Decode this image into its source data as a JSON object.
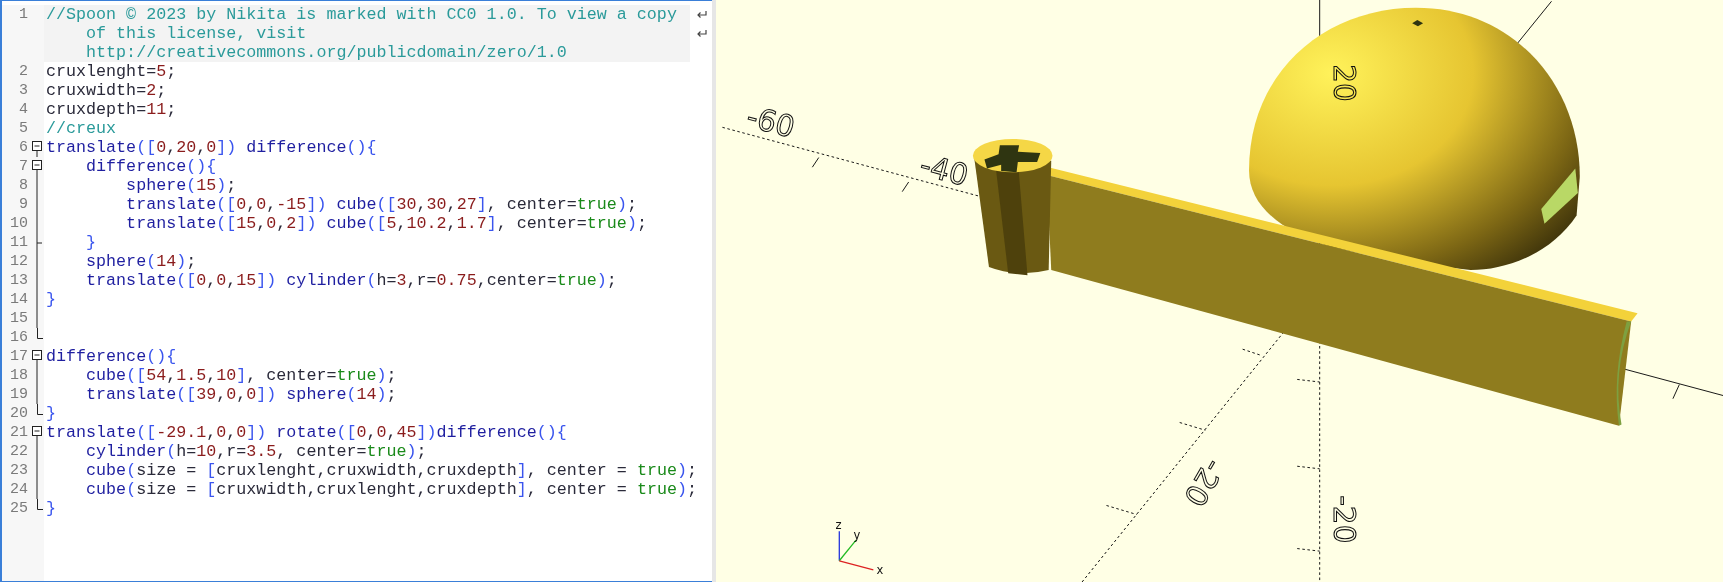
{
  "editor": {
    "lines": [
      {
        "number": "1",
        "kind": "plain",
        "current": true,
        "rows": [
          [
            {
              "kind": "cmt",
              "text": "//Spoon © 2023 by Nikita is marked with CC0 1.0. To view a copy"
            }
          ],
          [
            {
              "kind": "cmt",
              "text": "    of this license, visit"
            }
          ],
          [
            {
              "kind": "cmt",
              "text": "    http://creativecommons.org/publicdomain/zero/1.0"
            }
          ]
        ]
      },
      {
        "number": "2",
        "kind": "plain",
        "current": false,
        "rows": [
          [
            {
              "kind": "txt",
              "text": "cruxlenght="
            },
            {
              "kind": "num",
              "text": "5"
            },
            {
              "kind": "txt",
              "text": ";"
            }
          ]
        ]
      },
      {
        "number": "3",
        "kind": "plain",
        "current": false,
        "rows": [
          [
            {
              "kind": "txt",
              "text": "cruxwidth="
            },
            {
              "kind": "num",
              "text": "2"
            },
            {
              "kind": "txt",
              "text": ";"
            }
          ]
        ]
      },
      {
        "number": "4",
        "kind": "plain",
        "current": false,
        "rows": [
          [
            {
              "kind": "txt",
              "text": "cruxdepth="
            },
            {
              "kind": "num",
              "text": "11"
            },
            {
              "kind": "txt",
              "text": ";"
            }
          ]
        ]
      },
      {
        "number": "5",
        "kind": "plain",
        "current": false,
        "rows": [
          [
            {
              "kind": "cmt",
              "text": "//creux"
            }
          ]
        ]
      },
      {
        "number": "6",
        "kind": "open",
        "current": false,
        "rows": [
          [
            {
              "kind": "kw",
              "text": "translate"
            },
            {
              "kind": "br",
              "text": "(["
            },
            {
              "kind": "num",
              "text": "0"
            },
            {
              "kind": "txt",
              "text": ","
            },
            {
              "kind": "num",
              "text": "20"
            },
            {
              "kind": "txt",
              "text": ","
            },
            {
              "kind": "num",
              "text": "0"
            },
            {
              "kind": "br",
              "text": "])"
            },
            {
              "kind": "kw",
              "text": " difference"
            },
            {
              "kind": "br",
              "text": "(){"
            }
          ]
        ]
      },
      {
        "number": "7",
        "kind": "open",
        "current": false,
        "rows": [
          [
            {
              "kind": "kw",
              "text": "    difference"
            },
            {
              "kind": "br",
              "text": "(){"
            }
          ]
        ]
      },
      {
        "number": "8",
        "kind": "line",
        "current": false,
        "rows": [
          [
            {
              "kind": "kw",
              "text": "        sphere"
            },
            {
              "kind": "br",
              "text": "("
            },
            {
              "kind": "num",
              "text": "15"
            },
            {
              "kind": "br",
              "text": ")"
            },
            {
              "kind": "txt",
              "text": ";"
            }
          ]
        ]
      },
      {
        "number": "9",
        "kind": "line",
        "current": false,
        "rows": [
          [
            {
              "kind": "kw",
              "text": "        translate"
            },
            {
              "kind": "br",
              "text": "(["
            },
            {
              "kind": "num",
              "text": "0"
            },
            {
              "kind": "txt",
              "text": ","
            },
            {
              "kind": "num",
              "text": "0"
            },
            {
              "kind": "txt",
              "text": ","
            },
            {
              "kind": "num",
              "text": "-15"
            },
            {
              "kind": "br",
              "text": "])"
            },
            {
              "kind": "kw",
              "text": " cube"
            },
            {
              "kind": "br",
              "text": "(["
            },
            {
              "kind": "num",
              "text": "30"
            },
            {
              "kind": "txt",
              "text": ","
            },
            {
              "kind": "num",
              "text": "30"
            },
            {
              "kind": "txt",
              "text": ","
            },
            {
              "kind": "num",
              "text": "27"
            },
            {
              "kind": "br",
              "text": "]"
            },
            {
              "kind": "txt",
              "text": ", center="
            },
            {
              "kind": "bool",
              "text": "true"
            },
            {
              "kind": "br",
              "text": ")"
            },
            {
              "kind": "txt",
              "text": ";"
            }
          ]
        ]
      },
      {
        "number": "10",
        "kind": "line",
        "current": false,
        "rows": [
          [
            {
              "kind": "kw",
              "text": "        translate"
            },
            {
              "kind": "br",
              "text": "(["
            },
            {
              "kind": "num",
              "text": "15"
            },
            {
              "kind": "txt",
              "text": ","
            },
            {
              "kind": "num",
              "text": "0"
            },
            {
              "kind": "txt",
              "text": ","
            },
            {
              "kind": "num",
              "text": "2"
            },
            {
              "kind": "br",
              "text": "])"
            },
            {
              "kind": "kw",
              "text": " cube"
            },
            {
              "kind": "br",
              "text": "(["
            },
            {
              "kind": "num",
              "text": "5"
            },
            {
              "kind": "txt",
              "text": ","
            },
            {
              "kind": "num",
              "text": "10.2"
            },
            {
              "kind": "txt",
              "text": ","
            },
            {
              "kind": "num",
              "text": "1.7"
            },
            {
              "kind": "br",
              "text": "]"
            },
            {
              "kind": "txt",
              "text": ", center="
            },
            {
              "kind": "bool",
              "text": "true"
            },
            {
              "kind": "br",
              "text": ")"
            },
            {
              "kind": "txt",
              "text": ";"
            }
          ]
        ]
      },
      {
        "number": "11",
        "kind": "tick",
        "current": false,
        "rows": [
          [
            {
              "kind": "br",
              "text": "    }"
            }
          ]
        ]
      },
      {
        "number": "12",
        "kind": "line",
        "current": false,
        "rows": [
          [
            {
              "kind": "kw",
              "text": "    sphere"
            },
            {
              "kind": "br",
              "text": "("
            },
            {
              "kind": "num",
              "text": "14"
            },
            {
              "kind": "br",
              "text": ")"
            },
            {
              "kind": "txt",
              "text": ";"
            }
          ]
        ]
      },
      {
        "number": "13",
        "kind": "line",
        "current": false,
        "rows": [
          [
            {
              "kind": "kw",
              "text": "    translate"
            },
            {
              "kind": "br",
              "text": "(["
            },
            {
              "kind": "num",
              "text": "0"
            },
            {
              "kind": "txt",
              "text": ","
            },
            {
              "kind": "num",
              "text": "0"
            },
            {
              "kind": "txt",
              "text": ","
            },
            {
              "kind": "num",
              "text": "15"
            },
            {
              "kind": "br",
              "text": "])"
            },
            {
              "kind": "kw",
              "text": " cylinder"
            },
            {
              "kind": "br",
              "text": "("
            },
            {
              "kind": "txt",
              "text": "h="
            },
            {
              "kind": "num",
              "text": "3"
            },
            {
              "kind": "txt",
              "text": ",r="
            },
            {
              "kind": "num",
              "text": "0.75"
            },
            {
              "kind": "txt",
              "text": ",center="
            },
            {
              "kind": "bool",
              "text": "true"
            },
            {
              "kind": "br",
              "text": ")"
            },
            {
              "kind": "txt",
              "text": ";"
            }
          ]
        ]
      },
      {
        "number": "14",
        "kind": "line",
        "current": false,
        "rows": [
          [
            {
              "kind": "br",
              "text": "}"
            }
          ]
        ]
      },
      {
        "number": "15",
        "kind": "line",
        "current": false
      },
      {
        "number": "16",
        "kind": "end",
        "current": false
      },
      {
        "number": "17",
        "kind": "open",
        "current": false,
        "rows": [
          [
            {
              "kind": "kw",
              "text": "difference"
            },
            {
              "kind": "br",
              "text": "(){"
            }
          ]
        ]
      },
      {
        "number": "18",
        "kind": "line",
        "current": false,
        "rows": [
          [
            {
              "kind": "kw",
              "text": "    cube"
            },
            {
              "kind": "br",
              "text": "(["
            },
            {
              "kind": "num",
              "text": "54"
            },
            {
              "kind": "txt",
              "text": ","
            },
            {
              "kind": "num",
              "text": "1.5"
            },
            {
              "kind": "txt",
              "text": ","
            },
            {
              "kind": "num",
              "text": "10"
            },
            {
              "kind": "br",
              "text": "]"
            },
            {
              "kind": "txt",
              "text": ", center="
            },
            {
              "kind": "bool",
              "text": "true"
            },
            {
              "kind": "br",
              "text": ")"
            },
            {
              "kind": "txt",
              "text": ";"
            }
          ]
        ]
      },
      {
        "number": "19",
        "kind": "line",
        "current": false,
        "rows": [
          [
            {
              "kind": "kw",
              "text": "    translate"
            },
            {
              "kind": "br",
              "text": "(["
            },
            {
              "kind": "num",
              "text": "39"
            },
            {
              "kind": "txt",
              "text": ","
            },
            {
              "kind": "num",
              "text": "0"
            },
            {
              "kind": "txt",
              "text": ","
            },
            {
              "kind": "num",
              "text": "0"
            },
            {
              "kind": "br",
              "text": "])"
            },
            {
              "kind": "kw",
              "text": " sphere"
            },
            {
              "kind": "br",
              "text": "("
            },
            {
              "kind": "num",
              "text": "14"
            },
            {
              "kind": "br",
              "text": ")"
            },
            {
              "kind": "txt",
              "text": ";"
            }
          ]
        ]
      },
      {
        "number": "20",
        "kind": "end",
        "current": false,
        "rows": [
          [
            {
              "kind": "br",
              "text": "}"
            }
          ]
        ]
      },
      {
        "number": "21",
        "kind": "open",
        "current": false,
        "rows": [
          [
            {
              "kind": "kw",
              "text": "translate"
            },
            {
              "kind": "br",
              "text": "(["
            },
            {
              "kind": "num",
              "text": "-29.1"
            },
            {
              "kind": "txt",
              "text": ","
            },
            {
              "kind": "num",
              "text": "0"
            },
            {
              "kind": "txt",
              "text": ","
            },
            {
              "kind": "num",
              "text": "0"
            },
            {
              "kind": "br",
              "text": "])"
            },
            {
              "kind": "kw",
              "text": " rotate"
            },
            {
              "kind": "br",
              "text": "(["
            },
            {
              "kind": "num",
              "text": "0"
            },
            {
              "kind": "txt",
              "text": ","
            },
            {
              "kind": "num",
              "text": "0"
            },
            {
              "kind": "txt",
              "text": ","
            },
            {
              "kind": "num",
              "text": "45"
            },
            {
              "kind": "br",
              "text": "])"
            },
            {
              "kind": "kw",
              "text": "difference"
            },
            {
              "kind": "br",
              "text": "(){"
            }
          ]
        ]
      },
      {
        "number": "22",
        "kind": "line",
        "current": false,
        "rows": [
          [
            {
              "kind": "kw",
              "text": "    cylinder"
            },
            {
              "kind": "br",
              "text": "("
            },
            {
              "kind": "txt",
              "text": "h="
            },
            {
              "kind": "num",
              "text": "10"
            },
            {
              "kind": "txt",
              "text": ",r="
            },
            {
              "kind": "num",
              "text": "3.5"
            },
            {
              "kind": "txt",
              "text": ", center="
            },
            {
              "kind": "bool",
              "text": "true"
            },
            {
              "kind": "br",
              "text": ")"
            },
            {
              "kind": "txt",
              "text": ";"
            }
          ]
        ]
      },
      {
        "number": "23",
        "kind": "line",
        "current": false,
        "rows": [
          [
            {
              "kind": "kw",
              "text": "    cube"
            },
            {
              "kind": "br",
              "text": "("
            },
            {
              "kind": "txt",
              "text": "size = "
            },
            {
              "kind": "br",
              "text": "["
            },
            {
              "kind": "txt",
              "text": "cruxlenght,cruxwidth,cruxdepth"
            },
            {
              "kind": "br",
              "text": "]"
            },
            {
              "kind": "txt",
              "text": ", center = "
            },
            {
              "kind": "bool",
              "text": "true"
            },
            {
              "kind": "br",
              "text": ")"
            },
            {
              "kind": "txt",
              "text": ";"
            }
          ]
        ]
      },
      {
        "number": "24",
        "kind": "line",
        "current": false,
        "rows": [
          [
            {
              "kind": "kw",
              "text": "    cube"
            },
            {
              "kind": "br",
              "text": "("
            },
            {
              "kind": "txt",
              "text": "size = "
            },
            {
              "kind": "br",
              "text": "["
            },
            {
              "kind": "txt",
              "text": "cruxwidth,cruxlenght,cruxdepth"
            },
            {
              "kind": "br",
              "text": "]"
            },
            {
              "kind": "txt",
              "text": ", center = "
            },
            {
              "kind": "bool",
              "text": "true"
            },
            {
              "kind": "br",
              "text": ")"
            },
            {
              "kind": "txt",
              "text": ";"
            }
          ]
        ]
      },
      {
        "number": "25",
        "kind": "end",
        "current": false,
        "rows": [
          [
            {
              "kind": "br",
              "text": "}"
            }
          ]
        ]
      }
    ]
  },
  "viewport": {
    "axis_labels": [
      "-60",
      "-40",
      "20",
      "-20",
      "-20"
    ],
    "orientation_labels": [
      "z",
      "y",
      "x"
    ]
  }
}
